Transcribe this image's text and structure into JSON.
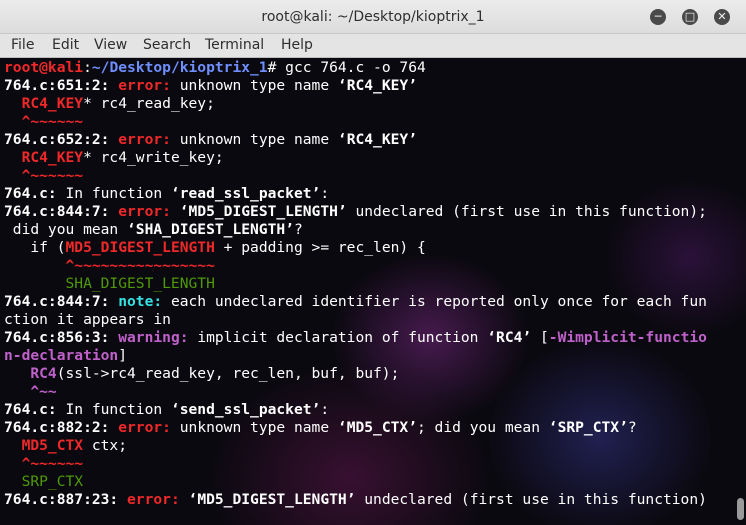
{
  "window": {
    "title": "root@kali: ~/Desktop/kioptrix_1",
    "minimize_glyph": "─",
    "maximize_glyph": "□",
    "close_glyph": "✕"
  },
  "menu": {
    "file": "File",
    "edit": "Edit",
    "view": "View",
    "search": "Search",
    "terminal": "Terminal",
    "help": "Help"
  },
  "terminal": {
    "colors": {
      "error": "#ef2929",
      "warning": "#c061cb",
      "note": "#34e2e2",
      "hint": "#4e9a06",
      "prompt_path": "#6f8fff",
      "prompt_user": "#ef2929"
    },
    "lines": [
      [
        {
          "c": "red",
          "t": "root@kali"
        },
        {
          "c": "plain",
          "t": ":"
        },
        {
          "c": "blue",
          "t": "~/Desktop/kioptrix_1"
        },
        {
          "c": "plain",
          "t": "# gcc 764.c -o 764"
        }
      ],
      [
        {
          "c": "white",
          "t": "764.c:651:2: "
        },
        {
          "c": "err",
          "t": "error: "
        },
        {
          "c": "plain",
          "t": "unknown type name "
        },
        {
          "c": "white",
          "t": "‘RC4_KEY’"
        }
      ],
      [
        {
          "c": "err",
          "t": "  RC4_KEY"
        },
        {
          "c": "plain",
          "t": "* rc4_read_key;"
        }
      ],
      [
        {
          "c": "caret",
          "t": "  ^~~~~~~"
        }
      ],
      [
        {
          "c": "white",
          "t": "764.c:652:2: "
        },
        {
          "c": "err",
          "t": "error: "
        },
        {
          "c": "plain",
          "t": "unknown type name "
        },
        {
          "c": "white",
          "t": "‘RC4_KEY’"
        }
      ],
      [
        {
          "c": "err",
          "t": "  RC4_KEY"
        },
        {
          "c": "plain",
          "t": "* rc4_write_key;"
        }
      ],
      [
        {
          "c": "caret",
          "t": "  ^~~~~~~"
        }
      ],
      [
        {
          "c": "white",
          "t": "764.c:"
        },
        {
          "c": "plain",
          "t": " In function "
        },
        {
          "c": "white",
          "t": "‘read_ssl_packet’"
        },
        {
          "c": "plain",
          "t": ":"
        }
      ],
      [
        {
          "c": "white",
          "t": "764.c:844:7: "
        },
        {
          "c": "err",
          "t": "error: "
        },
        {
          "c": "white",
          "t": "‘MD5_DIGEST_LENGTH’"
        },
        {
          "c": "plain",
          "t": " undeclared (first use in this function);"
        }
      ],
      [
        {
          "c": "plain",
          "t": " did you mean "
        },
        {
          "c": "white",
          "t": "‘SHA_DIGEST_LENGTH’"
        },
        {
          "c": "plain",
          "t": "?"
        }
      ],
      [
        {
          "c": "plain",
          "t": "   if ("
        },
        {
          "c": "err",
          "t": "MD5_DIGEST_LENGTH"
        },
        {
          "c": "plain",
          "t": " + padding >= rec_len) {"
        }
      ],
      [
        {
          "c": "caret",
          "t": "       ^~~~~~~~~~~~~~~~~"
        }
      ],
      [
        {
          "c": "green",
          "t": "       SHA_DIGEST_LENGTH"
        }
      ],
      [
        {
          "c": "white",
          "t": "764.c:844:7: "
        },
        {
          "c": "note",
          "t": "note: "
        },
        {
          "c": "plain",
          "t": "each undeclared identifier is reported only once for each fun"
        }
      ],
      [
        {
          "c": "plain",
          "t": "ction it appears in"
        }
      ],
      [
        {
          "c": "white",
          "t": "764.c:856:3: "
        },
        {
          "c": "warn",
          "t": "warning: "
        },
        {
          "c": "plain",
          "t": "implicit declaration of function "
        },
        {
          "c": "white",
          "t": "‘RC4’"
        },
        {
          "c": "plain",
          "t": " ["
        },
        {
          "c": "warn",
          "t": "-Wimplicit-functio"
        }
      ],
      [
        {
          "c": "warn",
          "t": "n-declaration"
        },
        {
          "c": "plain",
          "t": "]"
        }
      ],
      [
        {
          "c": "warn",
          "t": "   RC4"
        },
        {
          "c": "plain",
          "t": "(ssl->rc4_read_key, rec_len, buf, buf);"
        }
      ],
      [
        {
          "c": "caretw",
          "t": "   ^~~"
        }
      ],
      [
        {
          "c": "white",
          "t": "764.c:"
        },
        {
          "c": "plain",
          "t": " In function "
        },
        {
          "c": "white",
          "t": "‘send_ssl_packet’"
        },
        {
          "c": "plain",
          "t": ":"
        }
      ],
      [
        {
          "c": "white",
          "t": "764.c:882:2: "
        },
        {
          "c": "err",
          "t": "error: "
        },
        {
          "c": "plain",
          "t": "unknown type name "
        },
        {
          "c": "white",
          "t": "‘MD5_CTX’"
        },
        {
          "c": "plain",
          "t": "; did you mean "
        },
        {
          "c": "white",
          "t": "‘SRP_CTX’"
        },
        {
          "c": "plain",
          "t": "?"
        }
      ],
      [
        {
          "c": "err",
          "t": "  MD5_CTX"
        },
        {
          "c": "plain",
          "t": " ctx;"
        }
      ],
      [
        {
          "c": "caret",
          "t": "  ^~~~~~~"
        }
      ],
      [
        {
          "c": "green",
          "t": "  SRP_CTX"
        }
      ],
      [
        {
          "c": "white",
          "t": "764.c:887:23: "
        },
        {
          "c": "err",
          "t": "error: "
        },
        {
          "c": "white",
          "t": "‘MD5_DIGEST_LENGTH’"
        },
        {
          "c": "plain",
          "t": " undeclared (first use in this function)"
        }
      ]
    ]
  }
}
